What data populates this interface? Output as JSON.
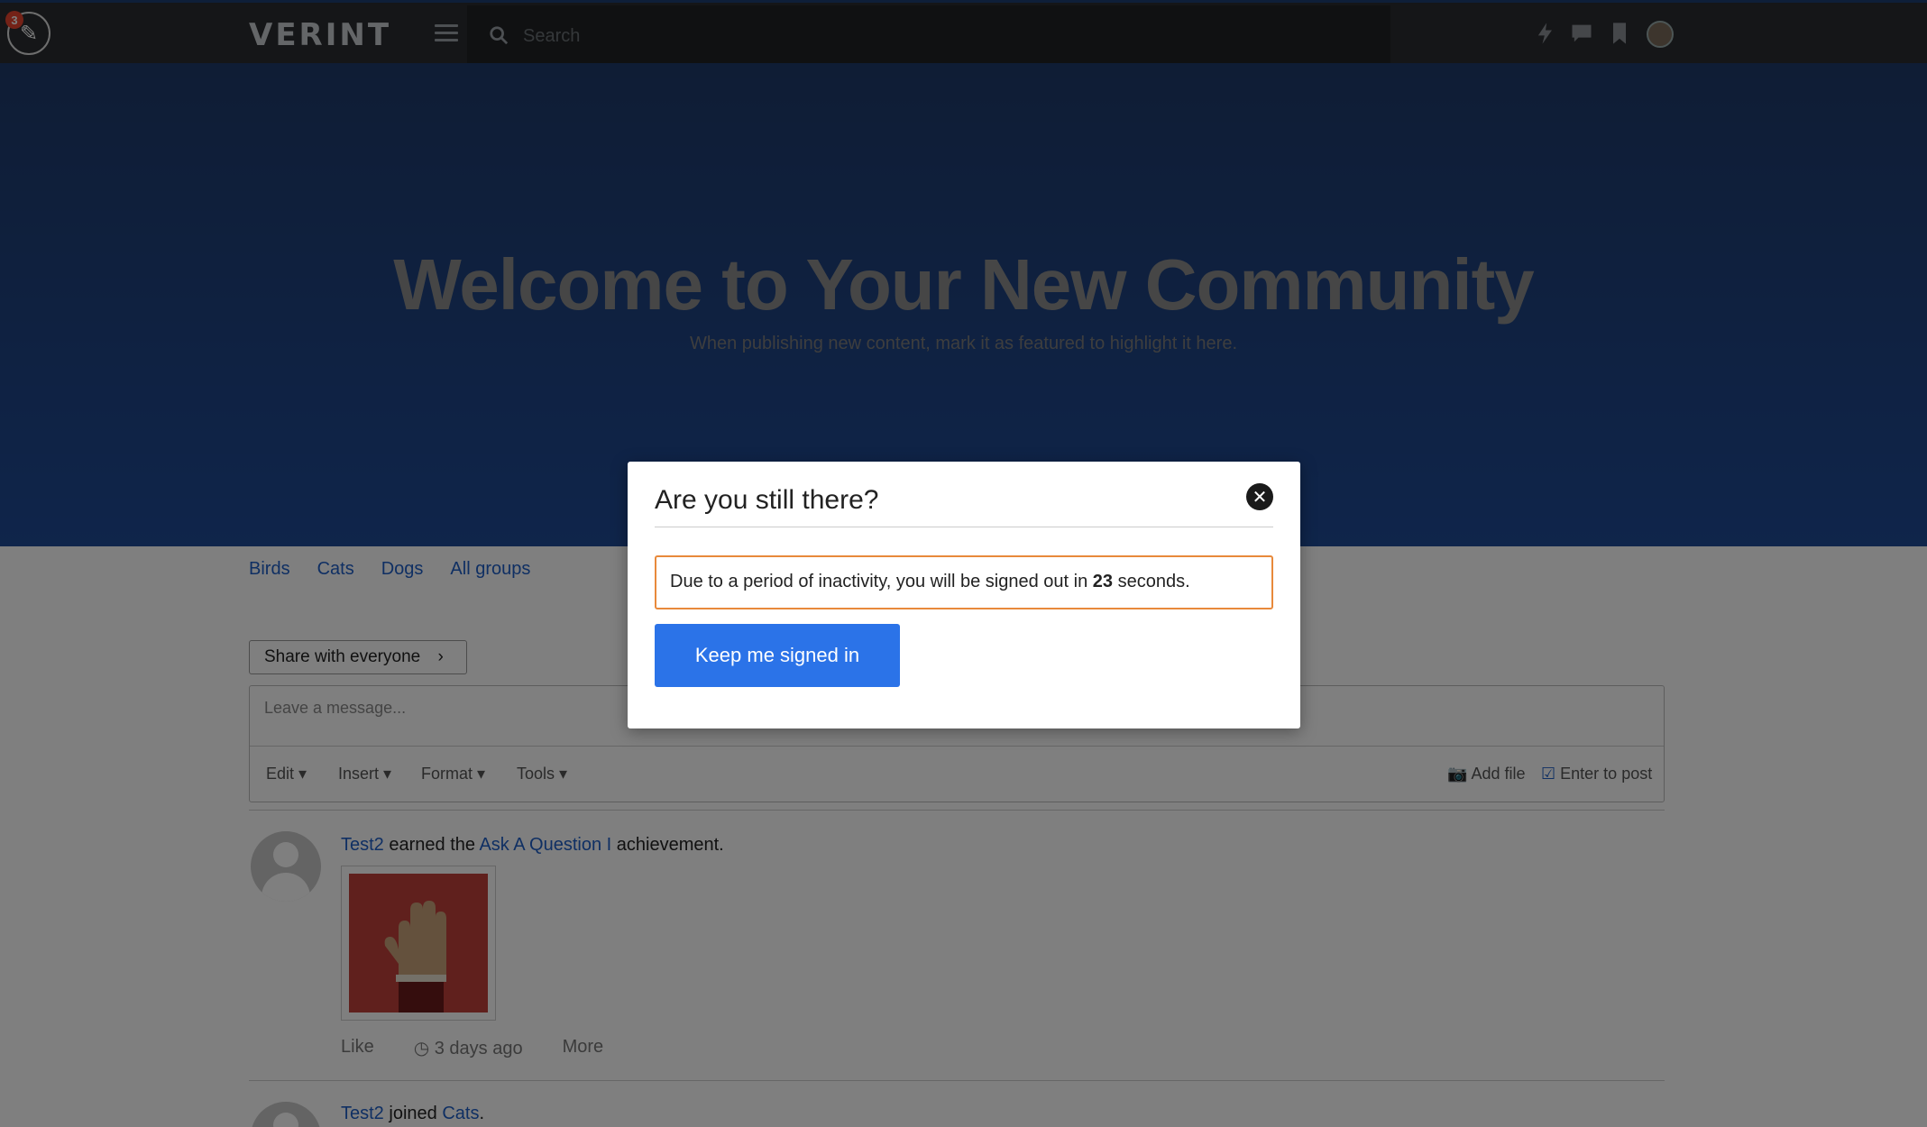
{
  "topbar": {
    "edit_badge_count": "3",
    "logo_text": "VERINT",
    "search_placeholder": "Search"
  },
  "hero": {
    "title": "Welcome to Your New Community",
    "subtitle": "When publishing new content, mark it as featured to highlight it here."
  },
  "groups": {
    "links": [
      "Birds",
      "Cats",
      "Dogs",
      "All groups"
    ]
  },
  "composer": {
    "share_label": "Share with everyone",
    "share_chevron": "›",
    "placeholder": "Leave a message...",
    "toolbar": [
      "Edit",
      "Insert",
      "Format",
      "Tools"
    ],
    "add_file_label": "Add file",
    "enter_to_post_label": "Enter to post"
  },
  "feed": {
    "items": [
      {
        "user": "Test2",
        "verb": "earned the",
        "target": "Ask A Question I",
        "suffix": "achievement.",
        "like": "Like",
        "time": "3 days ago",
        "more": "More"
      },
      {
        "user": "Test2",
        "verb": "joined",
        "target": "Cats",
        "suffix": "."
      }
    ]
  },
  "modal": {
    "title": "Are you still there?",
    "message_before": "Due to a period of inactivity, you will be signed out in",
    "seconds": "23",
    "message_after": "seconds.",
    "button_label": "Keep me signed in"
  },
  "colors": {
    "accent": "#2b73e8",
    "warning_border": "#e8893b",
    "link": "#1f5fc7",
    "hero": "#1e4a96"
  },
  "icons": [
    "edit-icon",
    "menu-icon",
    "search-icon",
    "lightning-icon",
    "chat-icon",
    "bookmark-icon",
    "avatar",
    "camera-icon",
    "checkbox-icon",
    "clock-icon",
    "close-icon"
  ]
}
